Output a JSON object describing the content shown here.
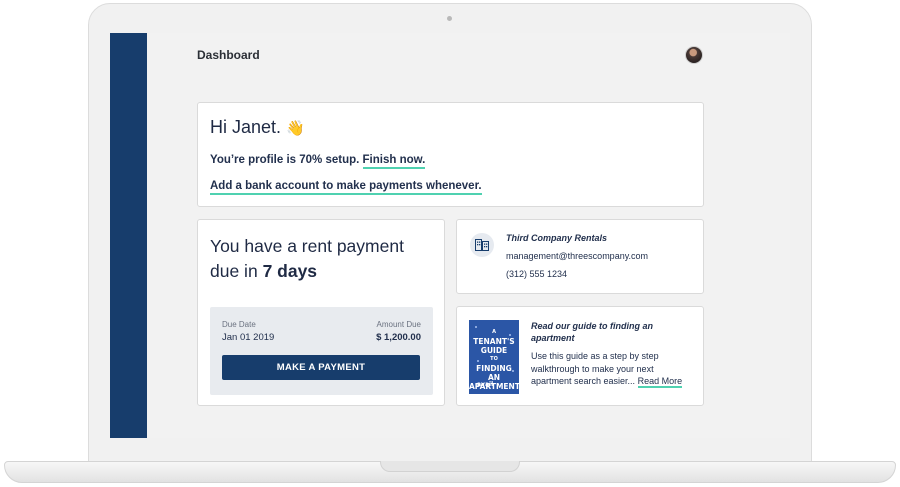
{
  "header": {
    "title": "Dashboard"
  },
  "greeting": {
    "title": "Hi Janet.",
    "wave_emoji": "👋",
    "profile_text": "You’re profile is 70% setup.",
    "profile_link": "Finish now.",
    "bank_link": "Add a bank account to make payments whenever."
  },
  "rent": {
    "title_prefix": "You have a rent payment due in",
    "title_emphasis": "7 days",
    "due_date_label": "Due Date",
    "due_date_value": "Jan 01 2019",
    "amount_label": "Amount Due",
    "amount_value": "$ 1,200.00",
    "pay_button": "MAKE A PAYMENT"
  },
  "landlord": {
    "icon": "building-icon",
    "name": "Third Company Rentals",
    "email": "management@threescompany.com",
    "phone": "(312) 555 1234"
  },
  "guide": {
    "book_lines": [
      "A",
      "TENANT'S",
      "GUIDE",
      "TO",
      "FINDING AN",
      "APARTMENT"
    ],
    "book_brand": "avail",
    "title": "Read our guide to finding an apartment",
    "body": "Use this guide as a step by step walkthrough to make your next apartment search easier...",
    "read_more": "Read More"
  },
  "colors": {
    "sidebar": "#173d6c",
    "primary_button": "#173d6c",
    "link_underline": "#4fd1b0",
    "book_cover": "#2b56a6"
  }
}
